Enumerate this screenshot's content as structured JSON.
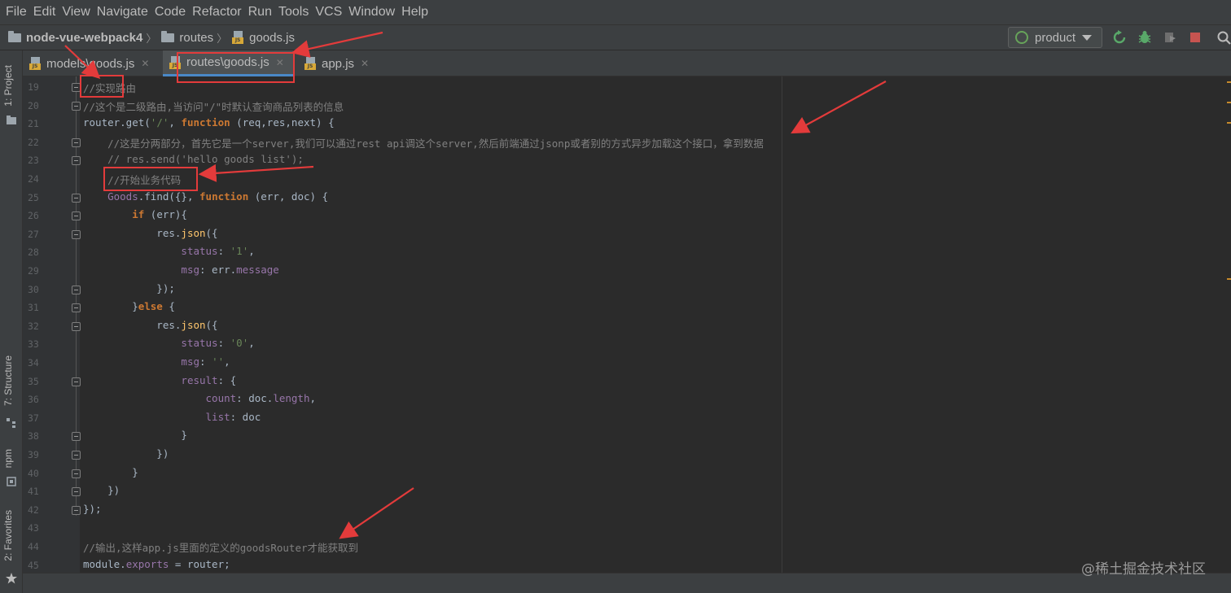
{
  "menu": [
    "File",
    "Edit",
    "View",
    "Navigate",
    "Code",
    "Refactor",
    "Run",
    "Tools",
    "VCS",
    "Window",
    "Help"
  ],
  "breadcrumb": {
    "project": "node-vue-webpack4",
    "folder": "routes",
    "file": "goods.js"
  },
  "run_config": {
    "label": "product"
  },
  "tabs": [
    {
      "label": "models\\goods.js",
      "active": false
    },
    {
      "label": "routes\\goods.js",
      "active": true
    },
    {
      "label": "app.js",
      "active": false
    }
  ],
  "tool_windows": {
    "project": "1: Project",
    "structure": "7: Structure",
    "npm": "npm",
    "favorites": "2: Favorites"
  },
  "editor": {
    "line_numbers": [
      "19",
      "20",
      "21",
      "22",
      "23",
      "24",
      "25",
      "26",
      "27",
      "28",
      "29",
      "30",
      "31",
      "32",
      "33",
      "34",
      "35",
      "36",
      "37",
      "38",
      "39",
      "40",
      "41",
      "42",
      "43",
      "44",
      "45"
    ],
    "lines": [
      "//实现路由",
      "//这个是二级路由,当访问\"/\"时默认查询商品列表的信息",
      "router.get('/', function (req,res,next) {",
      "    //这是分两部分，首先它是一个server,我们可以通过rest api调这个server,然后前端通过jsonp或者别的方式异步加载这个接口，拿到数据",
      "    // res.send('hello goods list');",
      "    //开始业务代码",
      "    Goods.find({}, function (err, doc) {",
      "        if (err){",
      "            res.json({",
      "                status: '1',",
      "                msg: err.message",
      "            });",
      "        }else {",
      "            res.json({",
      "                status: '0',",
      "                msg: '',",
      "                result: {",
      "                    count: doc.length,",
      "                    list: doc",
      "                }",
      "            })",
      "        }",
      "    })",
      "});",
      "",
      "//输出,这样app.js里面的定义的goodsRouter才能获取到",
      "module.exports = router;"
    ]
  },
  "watermark": "@稀土掘金技术社区",
  "colors": {
    "annotation": "#e33b3b",
    "editor_bg": "#2b2b2b",
    "chrome_bg": "#3c3f41",
    "active_tab_underline": "#4a88c7"
  }
}
